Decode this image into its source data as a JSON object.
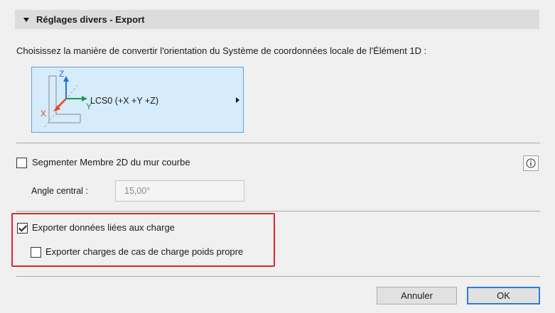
{
  "section": {
    "title": "Réglages divers - Export"
  },
  "lcs": {
    "description": "Choisissez la manière de convertir l'orientation du Système de coordonnées locale de l'Élément 1D :",
    "selected_label": "LCS0 (+X +Y +Z)",
    "axis_labels": {
      "z": "Z",
      "y": "Y",
      "x": "X"
    },
    "axis_colors": {
      "z": "#1e6fe0",
      "y": "#1a9a4a",
      "x": "#e64a19"
    }
  },
  "segment": {
    "label": "Segmenter Membre 2D du mur courbe",
    "checked": false,
    "angle_label": "Angle central :",
    "angle_value": "15,00°"
  },
  "export_loads": {
    "label": "Exporter données liées aux charge",
    "checked": true,
    "self_weight_label": "Exporter charges de cas de charge poids propre",
    "self_weight_checked": false
  },
  "buttons": {
    "cancel": "Annuler",
    "ok": "OK"
  },
  "colors": {
    "accent": "#2f7dd3",
    "highlight": "#e0262d",
    "selection_bg": "#d6ebfb"
  },
  "icons": {
    "info": "info-icon",
    "collapse": "triangle-down-icon",
    "submenu": "triangle-right-icon"
  }
}
